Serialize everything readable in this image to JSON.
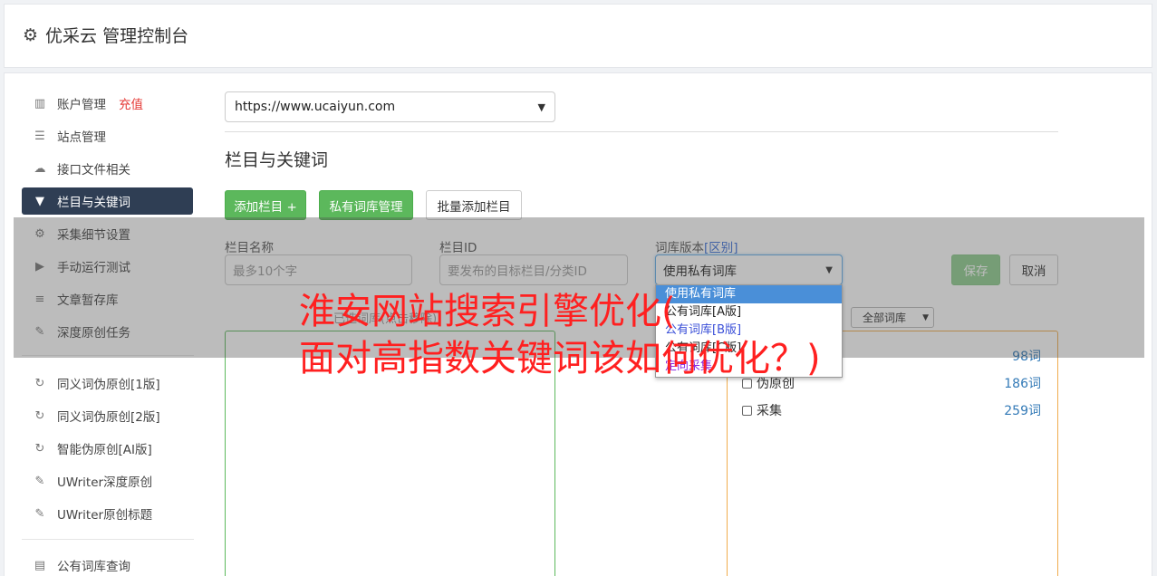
{
  "app": {
    "title": "优采云 管理控制台",
    "icon": "gear-icon"
  },
  "sidebar": {
    "items": [
      {
        "label": "账户管理",
        "badge": "充值",
        "icon": "bar-chart-icon"
      },
      {
        "label": "站点管理",
        "icon": "server-icon"
      },
      {
        "label": "接口文件相关",
        "icon": "cloud-upload-icon"
      },
      {
        "label": "栏目与关键词",
        "icon": "filter-icon",
        "active": true
      },
      {
        "label": "采集细节设置",
        "icon": "cogs-icon"
      },
      {
        "label": "手动运行测试",
        "icon": "play-circle-icon"
      },
      {
        "label": "文章暂存库",
        "icon": "database-icon"
      },
      {
        "label": "深度原创任务",
        "icon": "edit-icon"
      },
      {
        "label": "同义词伪原创[1版]",
        "icon": "refresh-icon"
      },
      {
        "label": "同义词伪原创[2版]",
        "icon": "refresh-icon"
      },
      {
        "label": "智能伪原创[AI版]",
        "icon": "refresh-icon"
      },
      {
        "label": "UWriter深度原创",
        "icon": "edit-icon"
      },
      {
        "label": "UWriter原创标题",
        "icon": "edit-icon"
      },
      {
        "label": "公有词库查询",
        "icon": "book-icon"
      }
    ]
  },
  "site_select": {
    "value": "https://www.ucaiyun.com"
  },
  "section": {
    "title": "栏目与关键词"
  },
  "toolbar": {
    "add_column": "添加栏目 +",
    "private_lib": "私有词库管理",
    "batch_add": "批量添加栏目"
  },
  "form": {
    "name_label": "栏目名称",
    "name_placeholder": "最多10个字",
    "id_label": "栏目ID",
    "id_placeholder": "要发布的目标栏目/分类ID",
    "lib_label": "词库版本",
    "lib_label_tag": "[区别]",
    "lib_value": "使用私有词库",
    "save": "保存",
    "cancel": "取消"
  },
  "dropdown": {
    "options": [
      "使用私有词库",
      "公有词库[A版]",
      "公有词库[B版]",
      "公有词库[C版]",
      "定向采集"
    ]
  },
  "left_panel": {
    "caption": "已选词库(点击移除)"
  },
  "right_panel": {
    "filter_value": "全部词库",
    "rows": [
      {
        "label": "",
        "count": "98词"
      },
      {
        "label": "伪原创",
        "count": "186词"
      },
      {
        "label": "采集",
        "count": "259词"
      }
    ]
  },
  "overlay_text": {
    "line1": "淮安网站搜索引擎优化(",
    "line2": "面对高指数关键词该如何优化？)"
  }
}
